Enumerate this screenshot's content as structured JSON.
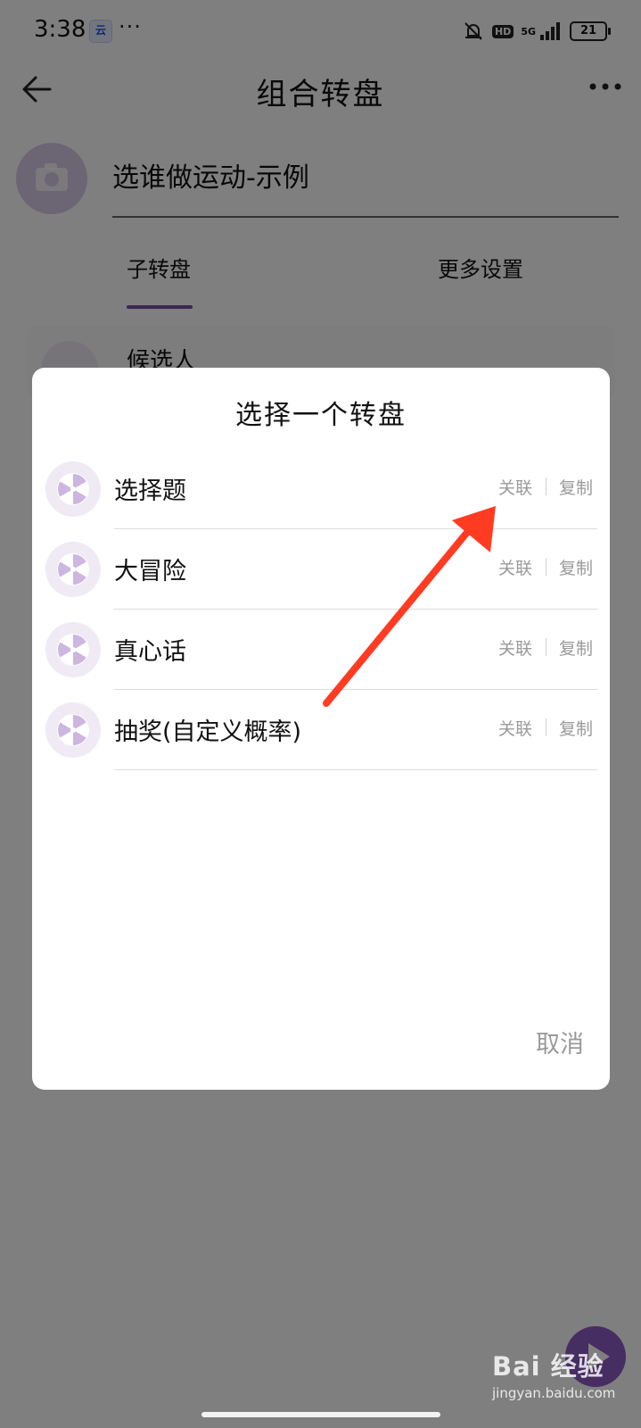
{
  "status_bar": {
    "time": "3:38",
    "app_badge": "云",
    "dots": "···",
    "hd": "HD",
    "network": "5G",
    "battery": "21"
  },
  "topbar": {
    "title": "组合转盘"
  },
  "form": {
    "name_value": "选谁做运动-示例"
  },
  "tabs": [
    {
      "label": "子转盘",
      "active": true
    },
    {
      "label": "更多设置",
      "active": false
    }
  ],
  "list": {
    "first_item": "候选人"
  },
  "dialog": {
    "title": "选择一个转盘",
    "rows": [
      {
        "label": "选择题",
        "link": "关联",
        "copy": "复制"
      },
      {
        "label": "大冒险",
        "link": "关联",
        "copy": "复制"
      },
      {
        "label": "真心话",
        "link": "关联",
        "copy": "复制"
      },
      {
        "label": "抽奖(自定义概率)",
        "link": "关联",
        "copy": "复制"
      }
    ],
    "cancel": "取消"
  },
  "watermark": {
    "main": "Bai 经验",
    "sub": "jingyan.baidu.com"
  },
  "colors": {
    "accent": "#7b4aa6",
    "scrim": "rgba(0,0,0,0.5)",
    "arrow": "#ff3b22"
  }
}
